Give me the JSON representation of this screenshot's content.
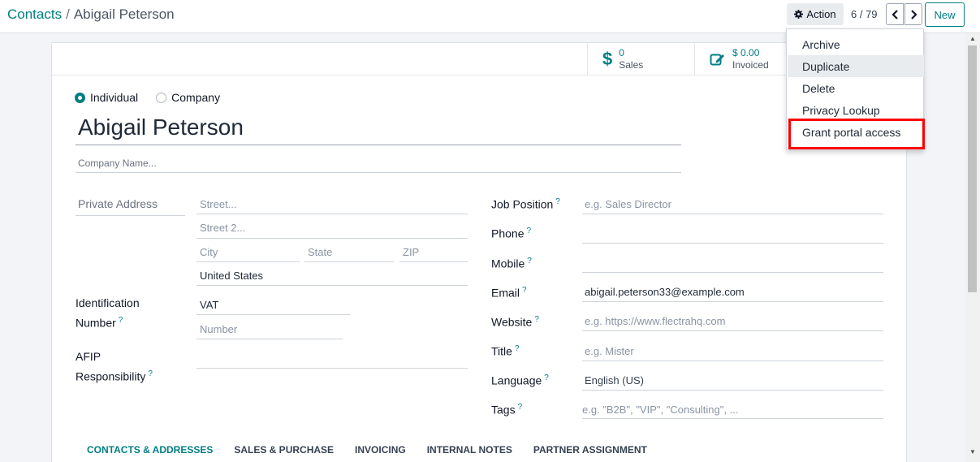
{
  "breadcrumb": {
    "parent": "Contacts",
    "separator": "/",
    "current": "Abigail Peterson"
  },
  "control": {
    "action_label": "Action",
    "pager": "6 / 79",
    "new_label": "New"
  },
  "stats": {
    "sales_value": "0",
    "sales_label": "Sales",
    "invoiced_value": "$ 0.00",
    "invoiced_label": "Invoiced"
  },
  "partner_type": {
    "individual": "Individual",
    "company": "Company",
    "selected": "Individual"
  },
  "name": "Abigail Peterson",
  "company_name_placeholder": "Company Name...",
  "left_fields": {
    "private_address_label": "Private Address",
    "street_placeholder": "Street...",
    "street2_placeholder": "Street 2...",
    "city_placeholder": "City",
    "state_placeholder": "State",
    "zip_placeholder": "ZIP",
    "country": "United States",
    "identification_label_1": "Identification",
    "identification_label_2": "Number",
    "vat": "VAT",
    "number_placeholder": "Number",
    "afip_label_1": "AFIP",
    "afip_label_2": "Responsibility"
  },
  "right_fields": {
    "job_position_label": "Job Position",
    "job_position_placeholder": "e.g. Sales Director",
    "phone_label": "Phone",
    "mobile_label": "Mobile",
    "email_label": "Email",
    "email_value": "abigail.peterson33@example.com",
    "website_label": "Website",
    "website_placeholder": "e.g. https://www.flectrahq.com",
    "title_label": "Title",
    "title_placeholder": "e.g. Mister",
    "language_label": "Language",
    "language_value": "English (US)",
    "tags_label": "Tags",
    "tags_placeholder": "e.g. \"B2B\", \"VIP\", \"Consulting\", ..."
  },
  "help_mark": "?",
  "tabs": [
    {
      "label": "CONTACTS & ADDRESSES"
    },
    {
      "label": "SALES & PURCHASE"
    },
    {
      "label": "INVOICING"
    },
    {
      "label": "INTERNAL NOTES"
    },
    {
      "label": "PARTNER ASSIGNMENT"
    }
  ],
  "dropdown": {
    "items": [
      {
        "label": "Archive"
      },
      {
        "label": "Duplicate"
      },
      {
        "label": "Delete"
      },
      {
        "label": "Privacy Lookup"
      },
      {
        "label": "Grant portal access"
      }
    ]
  },
  "colors": {
    "accent": "#017e84",
    "highlight": "#ff0000"
  }
}
